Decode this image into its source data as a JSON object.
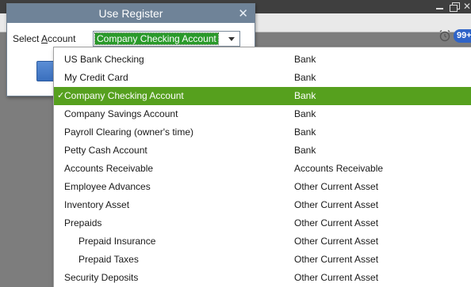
{
  "dialog": {
    "title": "Use Register",
    "select_label_prefix": "Select ",
    "select_label_accel": "A",
    "select_label_suffix": "ccount",
    "selected_value": "Company Checking Account"
  },
  "app": {
    "notification_count": "99+"
  },
  "accounts": [
    {
      "name": "US Bank Checking",
      "type": "Bank",
      "indent": 0,
      "selected": false
    },
    {
      "name": "My Credit Card",
      "type": "Bank",
      "indent": 0,
      "selected": false
    },
    {
      "name": "Company Checking Account",
      "type": "Bank",
      "indent": 0,
      "selected": true
    },
    {
      "name": "Company Savings Account",
      "type": "Bank",
      "indent": 0,
      "selected": false
    },
    {
      "name": "Payroll Clearing (owner's time)",
      "type": "Bank",
      "indent": 0,
      "selected": false
    },
    {
      "name": "Petty Cash Account",
      "type": "Bank",
      "indent": 0,
      "selected": false
    },
    {
      "name": "Accounts Receivable",
      "type": "Accounts Receivable",
      "indent": 0,
      "selected": false
    },
    {
      "name": "Employee Advances",
      "type": "Other Current Asset",
      "indent": 0,
      "selected": false
    },
    {
      "name": "Inventory Asset",
      "type": "Other Current Asset",
      "indent": 0,
      "selected": false
    },
    {
      "name": "Prepaids",
      "type": "Other Current Asset",
      "indent": 0,
      "selected": false
    },
    {
      "name": "Prepaid Insurance",
      "type": "Other Current Asset",
      "indent": 1,
      "selected": false
    },
    {
      "name": "Prepaid Taxes",
      "type": "Other Current Asset",
      "indent": 1,
      "selected": false
    },
    {
      "name": "Security Deposits",
      "type": "Other Current Asset",
      "indent": 0,
      "selected": false
    }
  ],
  "colors": {
    "selection": "#56a01e",
    "titlebar": "#6f8398",
    "badge": "#2f64c8"
  }
}
